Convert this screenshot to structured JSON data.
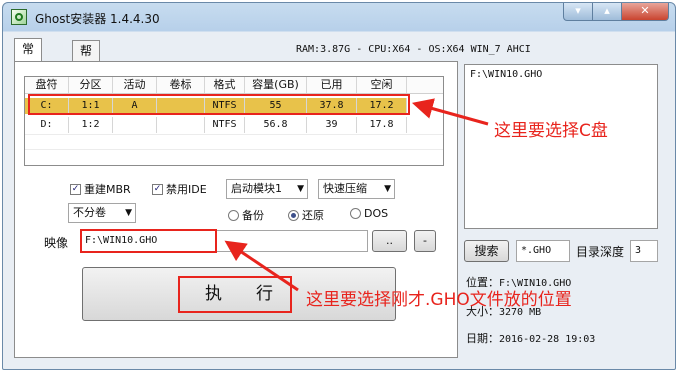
{
  "window": {
    "title": "Ghost安装器 1.4.4.30",
    "controls": {
      "minimize": "▾",
      "maximize": "▴",
      "close": "✕"
    }
  },
  "tabs": [
    {
      "label": "常规"
    },
    {
      "label": "帮助"
    }
  ],
  "sysinfo": "RAM:3.87G - CPU:X64 - OS:X64 WIN_7 AHCI",
  "partition_table": {
    "headers": [
      "盘符",
      "分区",
      "活动",
      "卷标",
      "格式",
      "容量(GB)",
      "已用",
      "空闲"
    ],
    "rows": [
      [
        "C:",
        "1:1",
        "A",
        "",
        "NTFS",
        "55",
        "37.8",
        "17.2"
      ],
      [
        "D:",
        "1:2",
        "",
        "",
        "NTFS",
        "56.8",
        "39",
        "17.8"
      ]
    ],
    "selected_row": 0,
    "selected_color": "#e8c24a"
  },
  "options": {
    "rebuild_mbr": {
      "label": "重建MBR",
      "checked": true
    },
    "disable_ide": {
      "label": "禁用IDE",
      "checked": true
    },
    "boot_module": "启动模块1",
    "compression": "快速压缩",
    "split": "不分卷",
    "mode": [
      {
        "label": "备份",
        "selected": false
      },
      {
        "label": "还原",
        "selected": true
      },
      {
        "label": "DOS",
        "selected": false
      }
    ]
  },
  "image": {
    "label": "映像",
    "path": "F:\\WIN10.GHO",
    "browse_label": "..",
    "minus_label": "-"
  },
  "execute_label": "执　　行",
  "right_panel": {
    "list_item": "F:\\WIN10.GHO",
    "search_label": "搜索",
    "search_pattern": "*.GHO",
    "depth_label": "目录深度",
    "depth_value": "3",
    "location_label": "位置：",
    "location_value": "F:\\WIN10.GHO",
    "size_label": "大小：",
    "size_value": "3270 MB",
    "date_label": "日期：",
    "date_value": "2016-02-28   19:03"
  },
  "annotations": {
    "select_c": "这里要选择C盘",
    "select_gho": "这里要选择刚才.GHO文件放的位置",
    "color": "#e8241d"
  }
}
